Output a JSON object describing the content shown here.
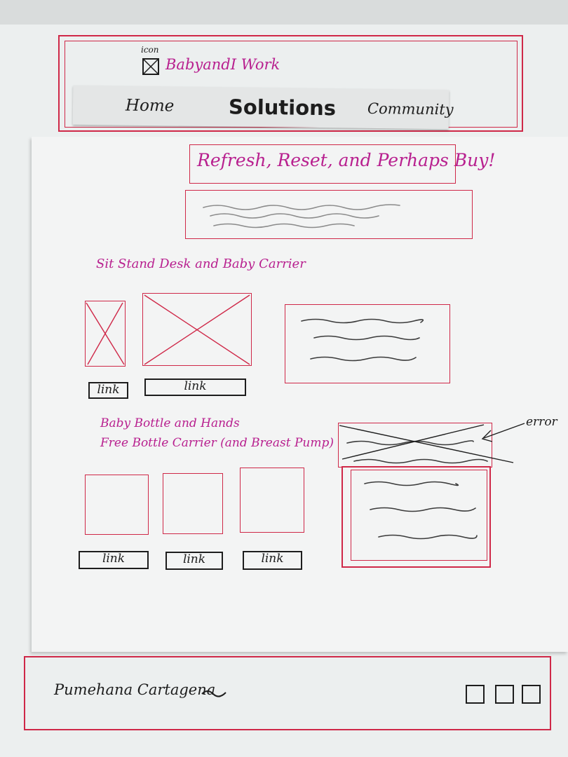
{
  "header": {
    "icon_label": "icon",
    "brand": "BabyandI Work",
    "nav": [
      "Home",
      "Solutions",
      "Community"
    ]
  },
  "hero": {
    "title": "Refresh, Reset, and Perhaps Buy!"
  },
  "section_1": {
    "title": "Sit Stand Desk and Baby Carrier",
    "links": [
      "link",
      "link"
    ]
  },
  "section_2": {
    "title_line_1": "Baby Bottle and Hands",
    "title_line_2": "Free Bottle Carrier (and Breast Pump)",
    "links": [
      "link",
      "link",
      "link"
    ],
    "annotation": "error"
  },
  "footer": {
    "author": "Pumehana Cartagena"
  },
  "colors": {
    "frame_red": "#cf2848",
    "marker_magenta": "#b8208f",
    "ink": "#1d1d1d"
  }
}
